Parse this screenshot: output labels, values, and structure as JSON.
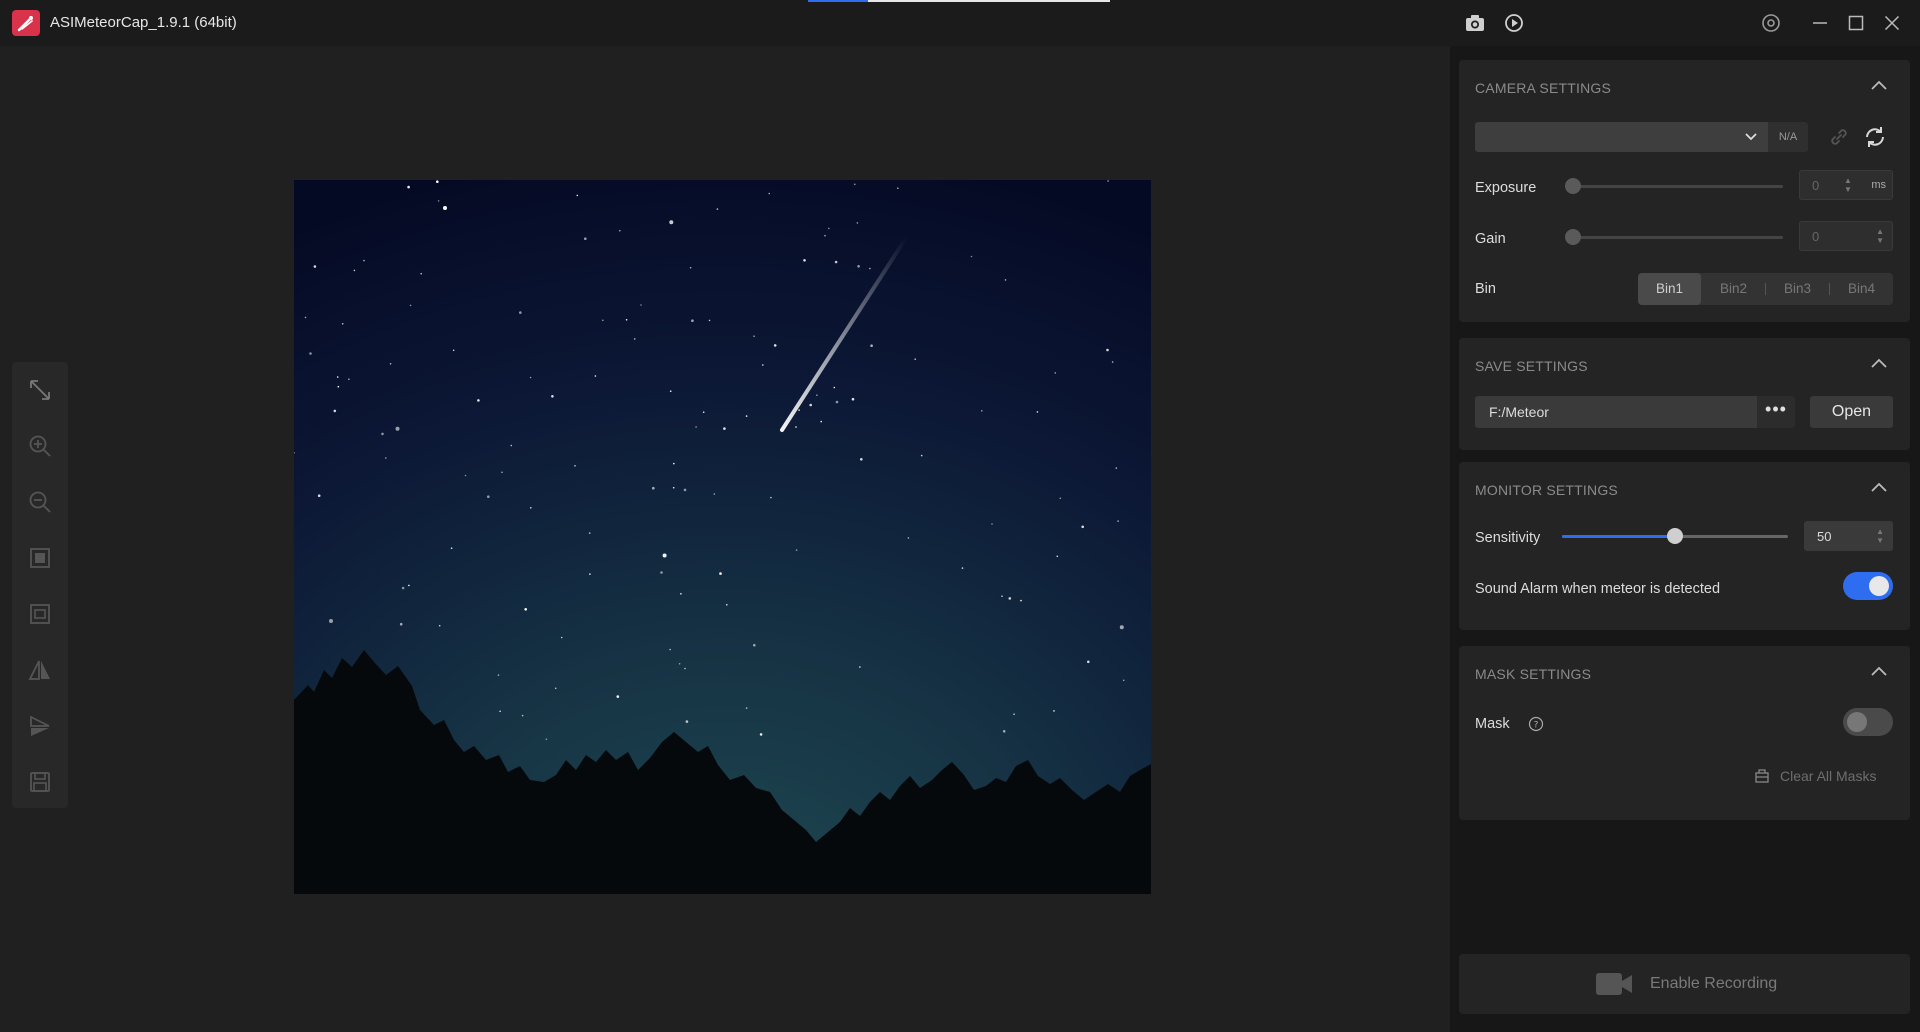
{
  "app": {
    "title": "ASIMeteorCap_1.9.1 (64bit)",
    "accent_color": "#2f6df0",
    "logo_color": "#d8334a"
  },
  "titlebar": {
    "icons": [
      "camera-icon",
      "play-record-icon",
      "settings-icon",
      "minimize-icon",
      "maximize-icon",
      "close-icon"
    ]
  },
  "toolbar": {
    "tools": [
      "expand-icon",
      "zoom-in-icon",
      "zoom-out-icon",
      "fit-icon",
      "actual-size-icon",
      "flip-horizontal-icon",
      "flip-vertical-icon",
      "save-icon"
    ]
  },
  "camera_settings": {
    "title": "CAMERA SETTINGS",
    "camera_select_value": "",
    "status": "N/A",
    "exposure_label": "Exposure",
    "exposure_value": "0",
    "exposure_unit": "ms",
    "gain_label": "Gain",
    "gain_value": "0",
    "bin_label": "Bin",
    "bin_options": [
      "Bin1",
      "Bin2",
      "Bin3",
      "Bin4"
    ],
    "bin_selected": "Bin1"
  },
  "save_settings": {
    "title": "SAVE SETTINGS",
    "path": "F:/Meteor",
    "more_label": "•••",
    "open_label": "Open"
  },
  "monitor_settings": {
    "title": "MONITOR SETTINGS",
    "sensitivity_label": "Sensitivity",
    "sensitivity_value": "50",
    "sensitivity_fraction": 0.5,
    "sound_alarm_label": "Sound Alarm when meteor is detected",
    "sound_alarm_on": true
  },
  "mask_settings": {
    "title": "MASK SETTINGS",
    "mask_label": "Mask",
    "mask_on": false,
    "clear_label": "Clear All Masks"
  },
  "recording": {
    "label": "Enable Recording"
  }
}
